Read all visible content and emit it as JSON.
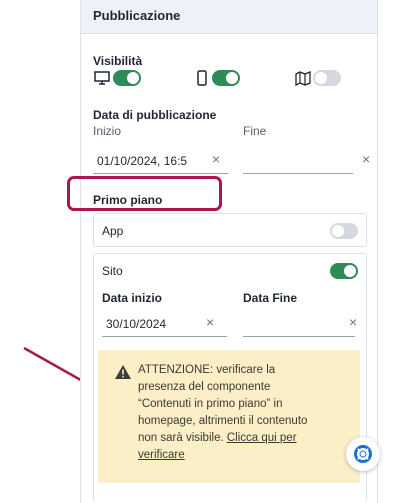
{
  "panel": {
    "title": "Pubblicazione"
  },
  "visibility": {
    "label": "Visibilità",
    "items": [
      {
        "icon": "desktop-icon",
        "state": "on"
      },
      {
        "icon": "mobile-icon",
        "state": "on"
      },
      {
        "icon": "map-icon",
        "state": "off"
      }
    ]
  },
  "publication_date": {
    "label": "Data di pubblicazione",
    "start_label": "Inizio",
    "end_label": "Fine",
    "start_value": "01/10/2024, 16:5",
    "end_value": ""
  },
  "primo_piano": {
    "label": "Primo piano",
    "app": {
      "label": "App",
      "state": "off"
    },
    "sito": {
      "label": "Sito",
      "state": "on",
      "start_label": "Data inizio",
      "end_label": "Data Fine",
      "start_value": "30/10/2024",
      "end_value": ""
    }
  },
  "warning": {
    "text": "ATTENZIONE: verificare la presenza del componente “Contenuti in primo piano” in homepage, altrimenti il contenuto non sarà visibile.",
    "link": "Clicca qui per verificare"
  },
  "colors": {
    "toggle_on": "#2e8b57",
    "toggle_off": "#d5d9df",
    "highlight": "#a8174f",
    "warning_bg": "#fbefc8",
    "header_bg": "#eef2f8"
  }
}
